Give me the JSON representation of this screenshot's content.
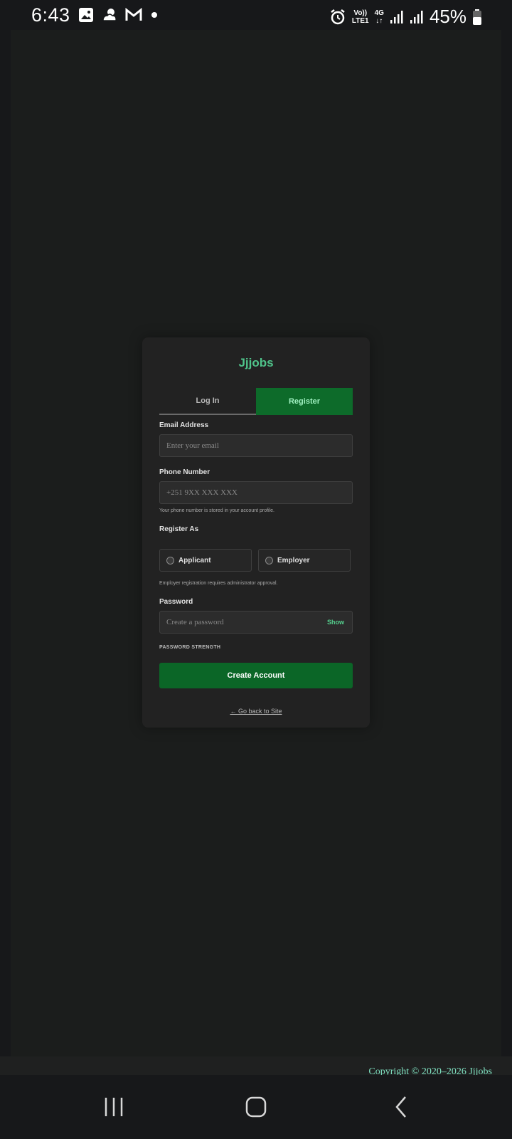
{
  "status_bar": {
    "time": "6:43",
    "battery": "45%",
    "network_top": "Vo))",
    "network_bottom": "LTE1",
    "network_type": "4G",
    "icons": [
      "gallery-icon",
      "weather-icon",
      "gmail-icon",
      "dot-icon",
      "alarm-icon",
      "signal-icon",
      "signal-icon",
      "battery-icon"
    ]
  },
  "card": {
    "brand": "Jjjobs",
    "tabs": {
      "login": "Log In",
      "register": "Register"
    },
    "email": {
      "label": "Email Address",
      "placeholder": "Enter your email"
    },
    "phone": {
      "label": "Phone Number",
      "placeholder": "+251 9XX XXX XXX",
      "hint": "Your phone number is stored in your account profile."
    },
    "register_as": {
      "label": "Register As",
      "options": [
        "Applicant",
        "Employer"
      ],
      "hint": "Employer registration requires administrator approval."
    },
    "password": {
      "label": "Password",
      "placeholder": "Create a password",
      "show": "Show"
    },
    "strength_label": "PASSWORD STRENGTH",
    "submit": "Create Account",
    "back_link": "← Go back to Site"
  },
  "footer": {
    "copyright": "Copyright © 2020–2026 Jjjobs"
  },
  "colors": {
    "accent": "#0b6627",
    "brand": "#4fc38a",
    "background": "#1b1d1c",
    "card": "#222222"
  }
}
